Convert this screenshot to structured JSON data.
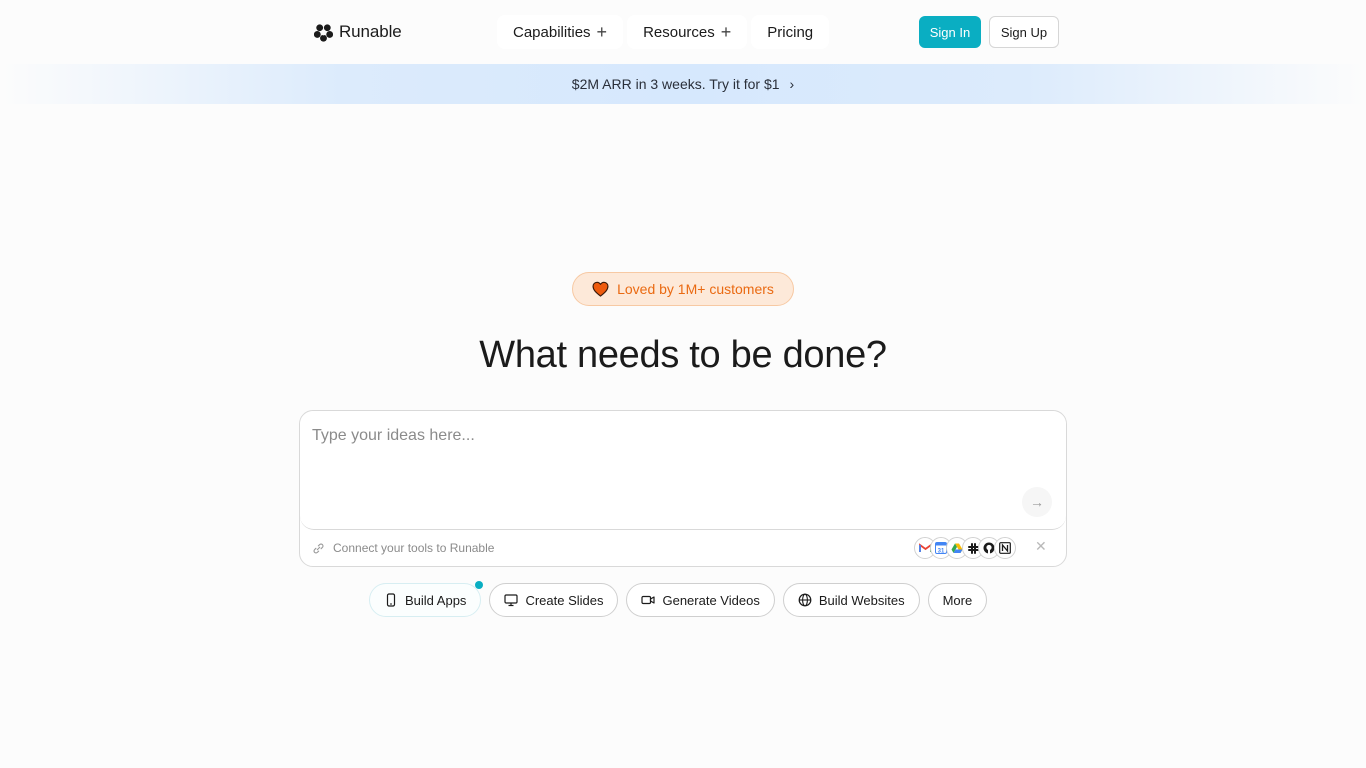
{
  "header": {
    "logo_text": "Runable",
    "nav": [
      {
        "label": "Capabilities",
        "has_plus": true
      },
      {
        "label": "Resources",
        "has_plus": true
      },
      {
        "label": "Pricing",
        "has_plus": false
      }
    ],
    "sign_in_label": "Sign In",
    "sign_up_label": "Sign Up"
  },
  "banner": {
    "text": "$2M ARR in 3 weeks. Try it for $1",
    "chevron": "›"
  },
  "hero": {
    "badge_text": "Loved by 1M+ customers",
    "headline": "What needs to be done?"
  },
  "composer": {
    "placeholder": "Type your ideas here...",
    "value": "",
    "connect_text": "Connect your tools to Runable",
    "tools": [
      "gmail-icon",
      "google-calendar-icon",
      "google-drive-icon",
      "slack-icon",
      "github-icon",
      "notion-icon"
    ]
  },
  "chips": [
    {
      "label": "Build Apps",
      "icon": "phone-icon"
    },
    {
      "label": "Create Slides",
      "icon": "monitor-icon"
    },
    {
      "label": "Generate Videos",
      "icon": "video-icon"
    },
    {
      "label": "Build Websites",
      "icon": "globe-icon"
    },
    {
      "label": "More",
      "icon": ""
    }
  ],
  "colors": {
    "accent": "#0aaec2",
    "badge_text": "#ea6a12",
    "badge_bg": "#fde9d9"
  }
}
